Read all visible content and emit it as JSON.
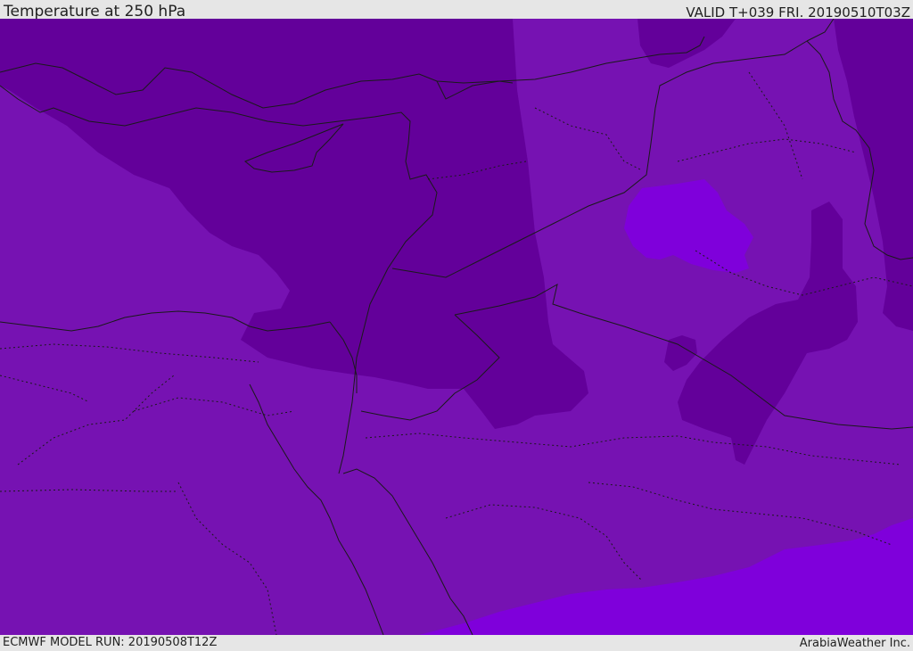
{
  "header": {
    "title": "Temperature at 250 hPa",
    "valid": "VALID T+039 FRI. 20190510T03Z"
  },
  "footer": {
    "model_run": "ECMWF MODEL RUN: 20190508T12Z",
    "credit": "ArabiaWeather Inc."
  },
  "colors": {
    "cold_band": "#63009a",
    "mid_band": "#7612b2",
    "warm_band": "#7f00db",
    "borders": "#1a1a1a"
  }
}
